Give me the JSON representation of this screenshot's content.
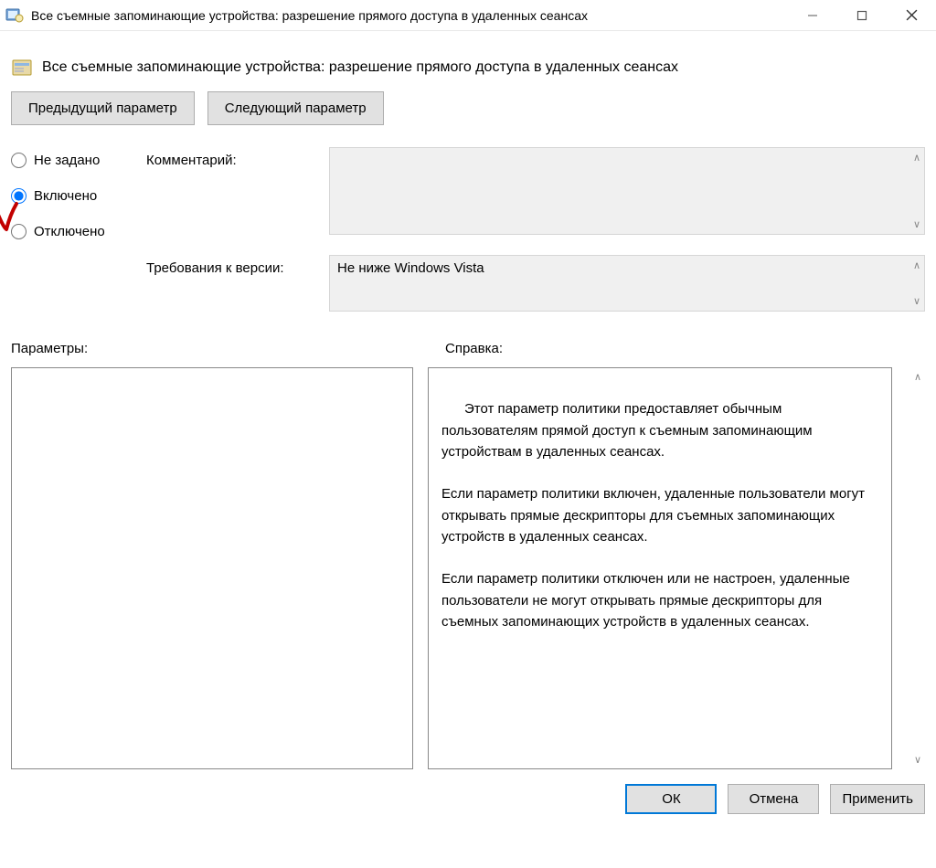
{
  "window": {
    "title": "Все съемные запоминающие устройства: разрешение прямого доступа в удаленных сеансах"
  },
  "heading": "Все съемные запоминающие устройства: разрешение прямого доступа в удаленных сеансах",
  "nav": {
    "prev": "Предыдущий параметр",
    "next": "Следующий параметр"
  },
  "radio": {
    "not_configured": "Не задано",
    "enabled": "Включено",
    "disabled": "Отключено",
    "selected": "enabled"
  },
  "labels": {
    "comment": "Комментарий:",
    "supported": "Требования к версии:",
    "options": "Параметры:",
    "help": "Справка:"
  },
  "comment_value": "",
  "supported_value": "Не ниже Windows Vista",
  "help_text": "Этот параметр политики предоставляет обычным пользователям прямой доступ к съемным запоминающим устройствам в удаленных сеансах.\n\nЕсли параметр политики включен, удаленные пользователи могут открывать прямые дескрипторы для съемных запоминающих устройств в удаленных сеансах.\n\nЕсли параметр политики отключен или не настроен, удаленные пользователи не могут открывать прямые дескрипторы для съемных запоминающих устройств в удаленных сеансах.",
  "footer": {
    "ok": "ОК",
    "cancel": "Отмена",
    "apply": "Применить"
  }
}
